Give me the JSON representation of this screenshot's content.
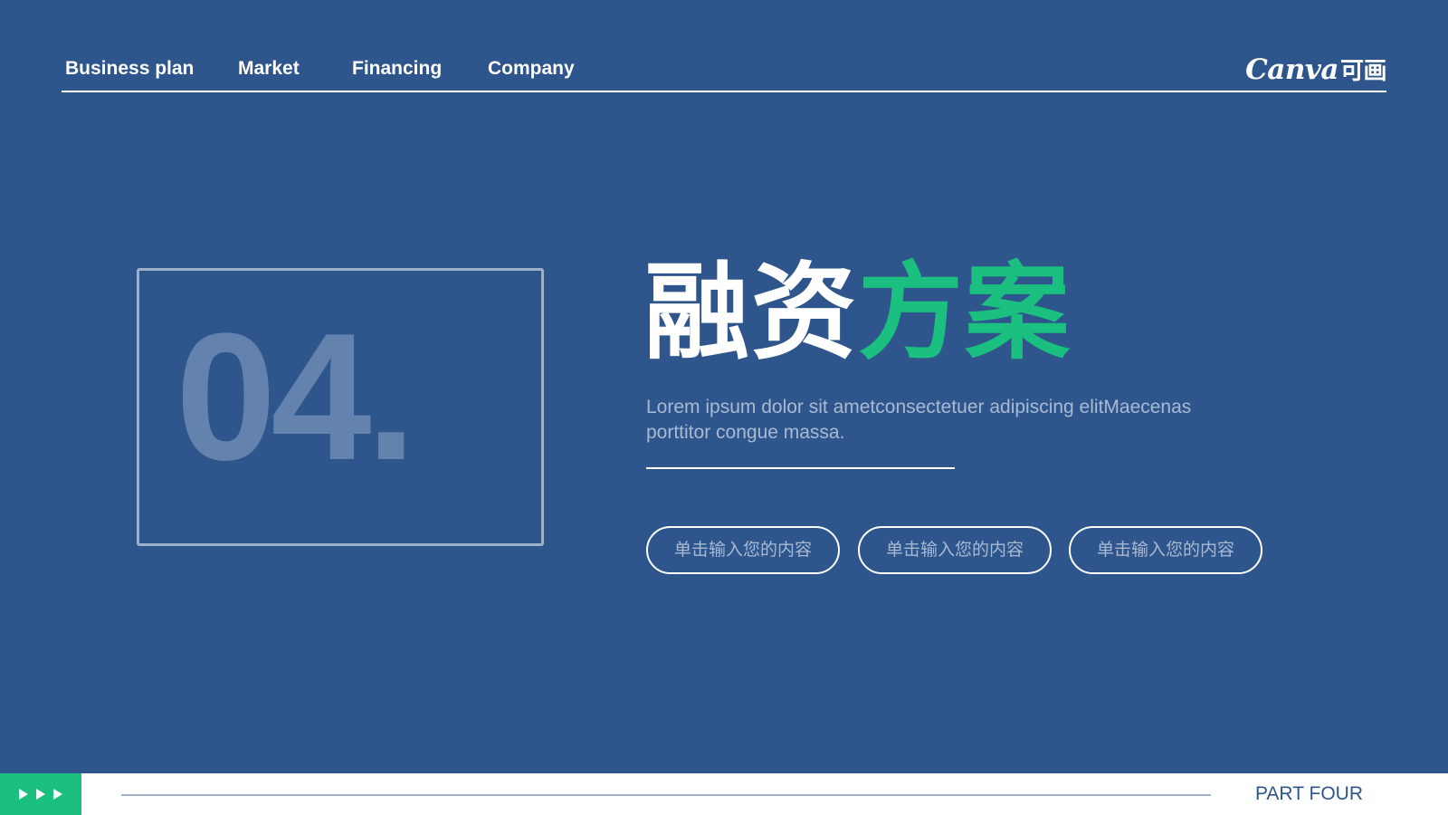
{
  "nav": {
    "items": [
      {
        "label": "Business plan"
      },
      {
        "label": "Market"
      },
      {
        "label": "Financing"
      },
      {
        "label": "Company"
      }
    ],
    "brand": {
      "latin": "Canva",
      "cn": "可画"
    }
  },
  "section": {
    "number": "04.",
    "title_part1": "融资",
    "title_part2": "方案",
    "subtitle": "Lorem ipsum dolor sit ametconsectetuer adipiscing elitMaecenas porttitor congue massa."
  },
  "buttons": [
    {
      "label": "单击输入您的内容"
    },
    {
      "label": "单击输入您的内容"
    },
    {
      "label": "单击输入您的内容"
    }
  ],
  "footer": {
    "part_label": "PART FOUR",
    "arrows_icon": "triple-play-icon"
  },
  "colors": {
    "background": "#2e568c",
    "accent_green": "#1bbf7f",
    "muted_text": "#a8b9d4",
    "number_fill": "#6482ae"
  }
}
